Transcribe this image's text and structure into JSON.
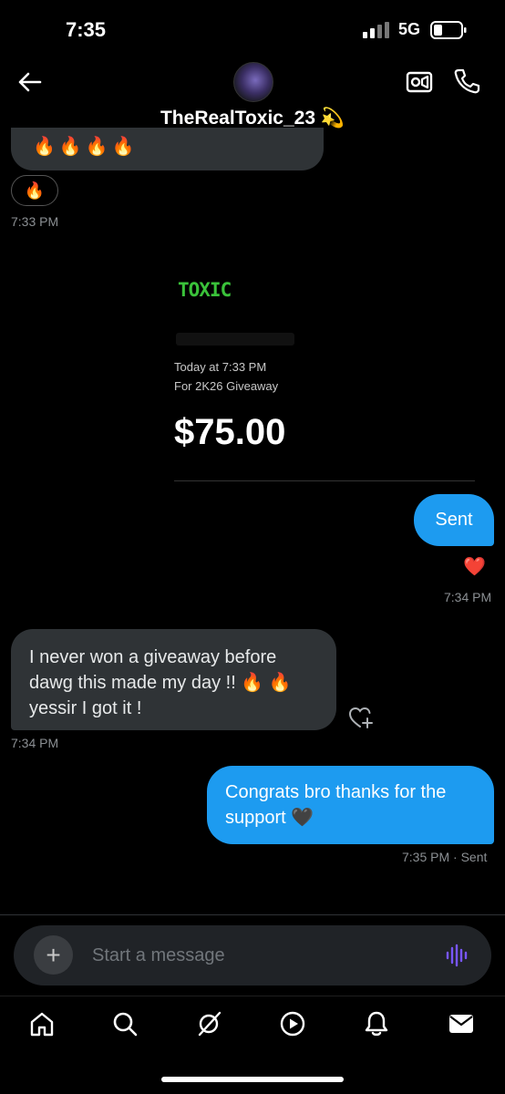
{
  "status_bar": {
    "time": "7:35",
    "network": "5G"
  },
  "header": {
    "username": "TheRealToxic_23 💫"
  },
  "messages": {
    "top_emojis": "🔥🔥🔥🔥",
    "top_reaction": "🔥",
    "ts1": "7:33 PM",
    "payment_card": {
      "logo": "TOXIC",
      "date": "Today at 7:33 PM",
      "note": "For 2K26 Giveaway",
      "amount": "$75.00"
    },
    "sent_text": "Sent",
    "sent_reaction": "❤️",
    "ts2": "7:34 PM",
    "incoming_text": "I never won a giveaway before dawg this made my day !! 🔥 🔥 yessir I got it !",
    "ts3": "7:34 PM",
    "outgoing_text": "Congrats bro thanks for the support 🖤",
    "ts4": "7:35 PM · Sent"
  },
  "composer": {
    "placeholder": "Start a message",
    "plus": "+"
  },
  "colors": {
    "accent": "#1d9bf0",
    "incoming": "#2f3336",
    "voice": "#7856ff",
    "heart": "#f0263a"
  }
}
